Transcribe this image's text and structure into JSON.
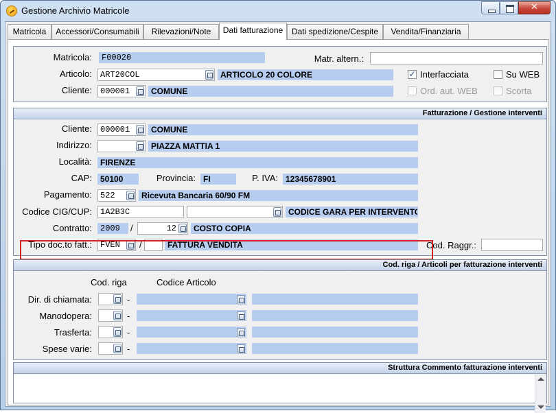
{
  "window": {
    "title": "Gestione Archivio Matricole"
  },
  "tabs": [
    {
      "label": "Matricola"
    },
    {
      "label": "Accessori/Consumabili"
    },
    {
      "label": "Rilevazioni/Note"
    },
    {
      "label": "Dati fatturazione"
    },
    {
      "label": "Dati spedizione/Cespite"
    },
    {
      "label": "Vendita/Finanziaria"
    }
  ],
  "top": {
    "matricola_label": "Matricola:",
    "matricola_value": "F00020",
    "matr_altern_label": "Matr. altern.:",
    "matr_altern_value": "",
    "articolo_label": "Articolo:",
    "articolo_code": "ART20COL",
    "articolo_desc": "ARTICOLO 20 COLORE",
    "cliente_label": "Cliente:",
    "cliente_code": "000001",
    "cliente_desc": "COMUNE",
    "interfacciata_label": "Interfacciata",
    "interfacciata_mark": "✓",
    "su_web_label": "Su WEB",
    "ord_aut_web_label": "Ord. aut. WEB",
    "scorta_label": "Scorta"
  },
  "fatturazione": {
    "header": "Fatturazione / Gestione interventi",
    "cliente_label": "Cliente:",
    "cliente_code": "000001",
    "cliente_desc": "COMUNE",
    "indirizzo_label": "Indirizzo:",
    "indirizzo_code": "",
    "indirizzo_desc": "PIAZZA MATTIA 1",
    "localita_label": "Località:",
    "localita_value": "FIRENZE",
    "cap_label": "CAP:",
    "cap_value": "50100",
    "provincia_label": "Provincia:",
    "provincia_value": "FI",
    "piva_label": "P. IVA:",
    "piva_value": "12345678901",
    "pagamento_label": "Pagamento:",
    "pagamento_code": "522",
    "pagamento_desc": "Ricevuta Bancaria 60/90 FM",
    "cig_label": "Codice CIG/CUP:",
    "cig_value": "1A2B3C",
    "cup_value": "",
    "cig_desc": "CODICE GARA PER INTERVENTO",
    "contratto_label": "Contratto:",
    "contratto_anno": "2009",
    "contratto_sep": "/",
    "contratto_num": "12",
    "contratto_desc": "COSTO COPIA",
    "tipodoc_label": "Tipo doc.to fatt.:",
    "tipodoc_code": "FVEN",
    "tipodoc_sep": "/",
    "tipodoc_num": "",
    "tipodoc_desc": "FATTURA VENDITA",
    "codraggr_label": "Cod. Raggr.:",
    "codraggr_value": ""
  },
  "codriga": {
    "header": "Cod. riga / Articoli per fatturazione interventi",
    "col_codriga": "Cod. riga",
    "col_codart": "Codice Articolo",
    "dash": "-",
    "rows": [
      {
        "label": "Dir. di chiamata:"
      },
      {
        "label": "Manodopera:"
      },
      {
        "label": "Trasferta:"
      },
      {
        "label": "Spese varie:"
      }
    ]
  },
  "commento": {
    "header": "Struttura Commento fatturazione interventi",
    "text": ""
  }
}
